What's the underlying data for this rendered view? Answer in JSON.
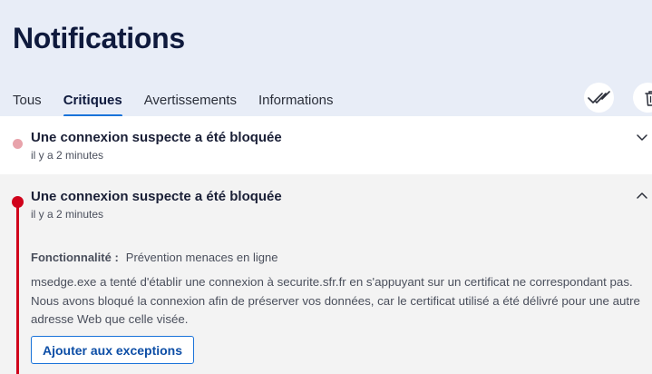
{
  "page": {
    "title": "Notifications"
  },
  "tabs": [
    {
      "label": "Tous"
    },
    {
      "label": "Critiques"
    },
    {
      "label": "Avertissements"
    },
    {
      "label": "Informations"
    }
  ],
  "toolbar": {
    "mark_read_icon": "double-check-icon",
    "delete_icon": "trash-icon"
  },
  "notifications": [
    {
      "title": "Une connexion suspecte a été bloquée",
      "time": "il y a 2 minutes",
      "expanded": false,
      "indicator_color": "#e8a3ab"
    },
    {
      "title": "Une connexion suspecte a été bloquée",
      "time": "il y a 2 minutes",
      "expanded": true,
      "indicator_color": "#d0021b",
      "feature_label": "Fonctionnalité :",
      "feature_value": "Prévention menaces en ligne",
      "description": "msedge.exe a tenté d'établir une connexion à securite.sfr.fr en s'appuyant sur un certificat ne correspondant pas. Nous avons bloqué la connexion afin de préserver vos données, car le certificat utilisé a été délivré pour une autre adresse Web que celle visée.",
      "action_label": "Ajouter aux exceptions"
    }
  ],
  "colors": {
    "accent": "#1a73d9",
    "critical": "#d0021b",
    "header_bg": "#e8edf7"
  }
}
